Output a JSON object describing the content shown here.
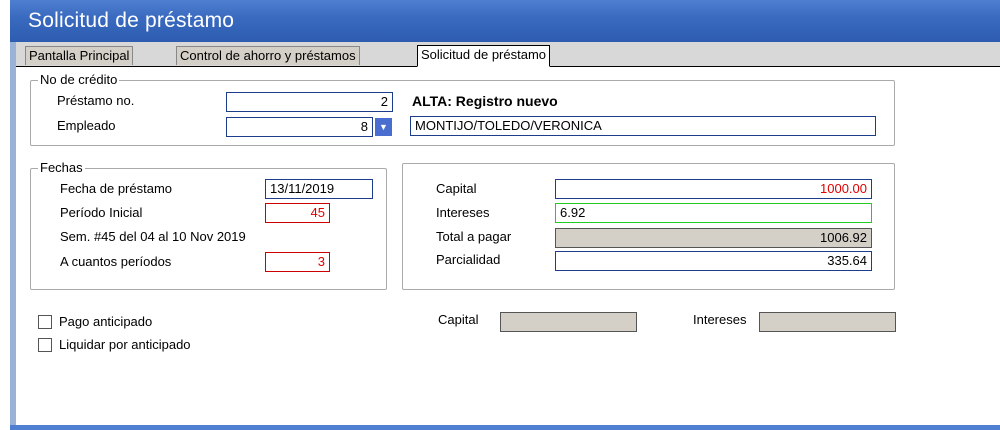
{
  "window": {
    "title": "Solicitud de préstamo"
  },
  "tabs": [
    {
      "label": "Pantalla Principal"
    },
    {
      "label": "Control de ahorro y préstamos"
    },
    {
      "label": "Solicitud de préstamo"
    }
  ],
  "credito": {
    "legend": "No de crédito",
    "prestamo_label": "Préstamo no.",
    "prestamo_value": "2",
    "status_text": "ALTA: Registro nuevo",
    "empleado_label": "Empleado",
    "empleado_value": "8",
    "empleado_nombre": "MONTIJO/TOLEDO/VERONICA"
  },
  "fechas": {
    "legend": "Fechas",
    "fecha_label": "Fecha de préstamo",
    "fecha_value": "13/11/2019",
    "periodo_label": "Período Inicial",
    "periodo_value": "45",
    "semana_text": "Sem. #45 del 04 al 10 Nov 2019",
    "cuantos_label": "A cuantos períodos",
    "cuantos_value": "3"
  },
  "montos": {
    "capital_label": "Capital",
    "capital_value": "1000.00",
    "intereses_label": "Intereses",
    "intereses_value": "6.92",
    "total_label": "Total a pagar",
    "total_value": "1006.92",
    "parcialidad_label": "Parcialidad",
    "parcialidad_value": "335.64"
  },
  "anticipado": {
    "pago_label": "Pago anticipado",
    "liquidar_label": "Liquidar por anticipado",
    "capital_label": "Capital",
    "capital_value": "",
    "intereses_label": "Intereses",
    "intereses_value": ""
  },
  "colors": {
    "accent": "#3a6bc0",
    "red_value": "#e00000",
    "focus_border": "#22cc22"
  }
}
